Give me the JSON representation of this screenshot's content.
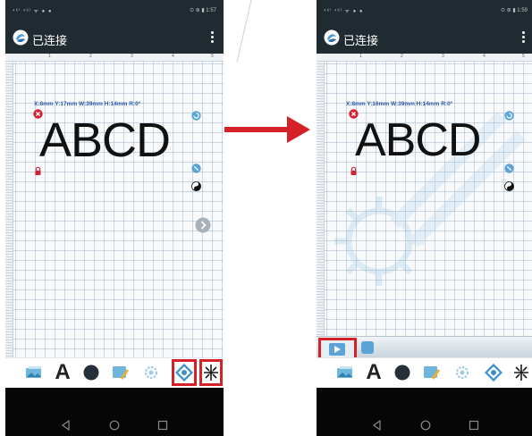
{
  "left": {
    "status_left": "⁴⁶ⁱ ⁴⁶ˡ ᯤ ● ●",
    "status_right": "⊙ ⊛ ▮ 1:57",
    "app_title": "已连接",
    "ruler_numbers": [
      "1",
      "2",
      "3",
      "4",
      "5"
    ],
    "coords": "X:8mm  Y:17mm  W:39mm  H:14mm  R:0°",
    "text_object": "ABCD"
  },
  "right": {
    "status_left": "⁴⁶ⁱ ⁴⁶ˡ ᯤ ● ●",
    "status_right": "⊙ ⊛ ▮ 1:59",
    "app_title": "已连接",
    "ruler_numbers": [
      "1",
      "2",
      "3",
      "4",
      "5"
    ],
    "coords": "X:8mm  Y:16mm  W:39mm  H:14mm  R:0°",
    "text_object": "ABCD"
  },
  "toolbar_icons": [
    "image-icon",
    "text-icon",
    "shape-icon",
    "edit-icon",
    "settings-icon",
    "preview-icon",
    "laser-icon"
  ],
  "colors": {
    "highlight": "#d42027",
    "appbar": "#1f2b30",
    "accent_blue": "#5aa3d6",
    "arrow": "#d42027"
  }
}
